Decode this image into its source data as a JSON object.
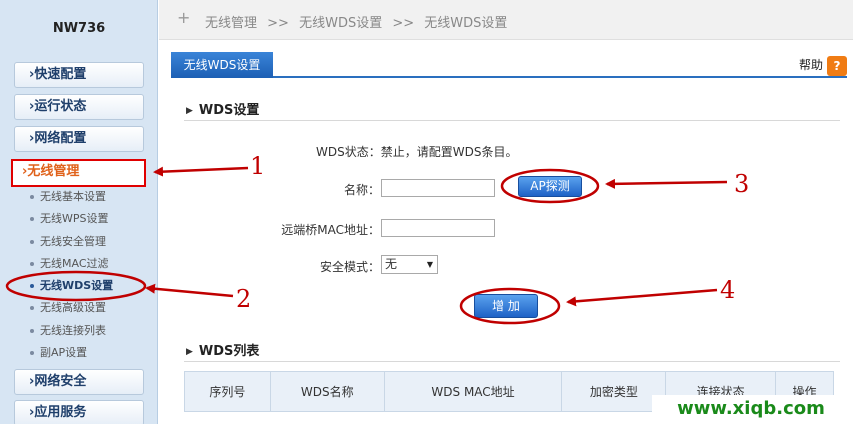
{
  "sidebar": {
    "model": "NW736",
    "menu": {
      "quick": "快速配置",
      "status": "运行状态",
      "network": "网络配置",
      "wireless": "无线管理",
      "security": "网络安全",
      "apps": "应用服务"
    },
    "arrow": "›",
    "sub_items": [
      "无线基本设置",
      "无线WPS设置",
      "无线安全管理",
      "无线MAC过滤",
      "无线WDS设置",
      "无线高级设置",
      "无线连接列表",
      "副AP设置"
    ]
  },
  "breadcrumb": {
    "items": [
      "无线管理",
      ">>",
      "无线WDS设置",
      ">>",
      "无线WDS设置"
    ]
  },
  "tab": {
    "label": "无线WDS设置"
  },
  "help": {
    "label": "帮助",
    "icon": "?"
  },
  "wds_settings": {
    "heading": "WDS设置",
    "status_text": "WDS状态：禁止，请配置WDS条目。",
    "name_label": "名称：",
    "name_value": "",
    "ap_scan_button": "AP探测",
    "remote_mac_label": "远端桥MAC地址：",
    "remote_mac_value": "",
    "security_label": "安全模式：",
    "security_selected": "无",
    "add_button": "增 加"
  },
  "wds_list": {
    "heading": "WDS列表",
    "columns": [
      "序列号",
      "WDS名称",
      "WDS MAC地址",
      "加密类型",
      "连接状态",
      "操作"
    ]
  },
  "annotations": [
    "1",
    "2",
    "3",
    "4"
  ],
  "watermark": "www.xiqb.com",
  "colors": {
    "accent_blue": "#1c5fb4",
    "annotation_red": "#c00000",
    "active_orange": "#e0611a",
    "watermark_green": "#1a8a1a"
  }
}
